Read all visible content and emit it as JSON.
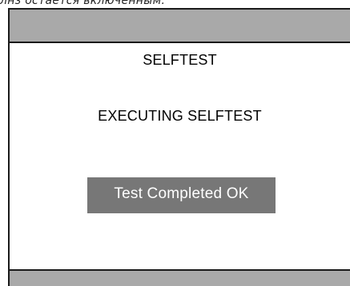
{
  "caption": {
    "text": "лнз остается включенным."
  },
  "screen": {
    "title": "SELFTEST",
    "status": "EXECUTING SELFTEST",
    "result": "Test Completed OK"
  },
  "colors": {
    "bar_gray": "#a9a9a9",
    "result_box": "#777777",
    "frame": "#1a1a1a"
  }
}
